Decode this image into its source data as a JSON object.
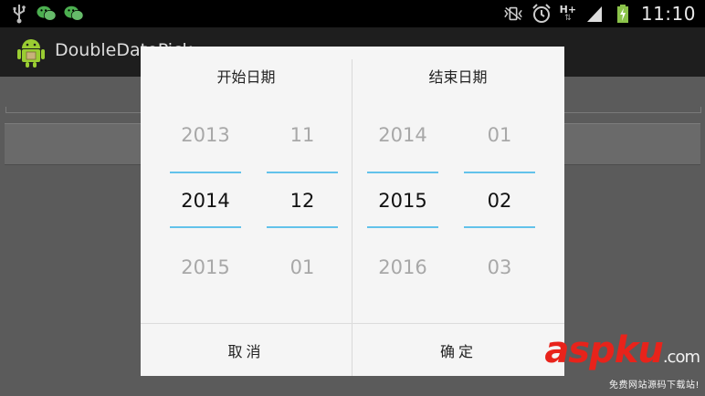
{
  "status_bar": {
    "time": "11:10",
    "network_label": "H+",
    "left_icons": [
      "usb-icon",
      "wechat-icon",
      "wechat-icon"
    ],
    "right_icons": [
      "vibrate-icon",
      "alarm-icon",
      "network-icon",
      "signal-icon",
      "battery-icon"
    ]
  },
  "action_bar": {
    "title": "DoubleDatePick"
  },
  "dialog": {
    "start": {
      "title": "开始日期",
      "year": {
        "prev": "2013",
        "current": "2014",
        "next": "2015"
      },
      "month": {
        "prev": "11",
        "current": "12",
        "next": "01"
      }
    },
    "end": {
      "title": "结束日期",
      "year": {
        "prev": "2014",
        "current": "2015",
        "next": "2016"
      },
      "month": {
        "prev": "01",
        "current": "02",
        "next": "03"
      }
    },
    "cancel_label": "取消",
    "ok_label": "确定"
  },
  "watermark": {
    "logo": "aspku",
    "logo_suffix": ".com",
    "tagline": "免费网站源码下载站!"
  },
  "colors": {
    "accent": "#62c2ea",
    "dialog_bg": "#f5f5f5",
    "watermark_red": "#e8231b"
  }
}
